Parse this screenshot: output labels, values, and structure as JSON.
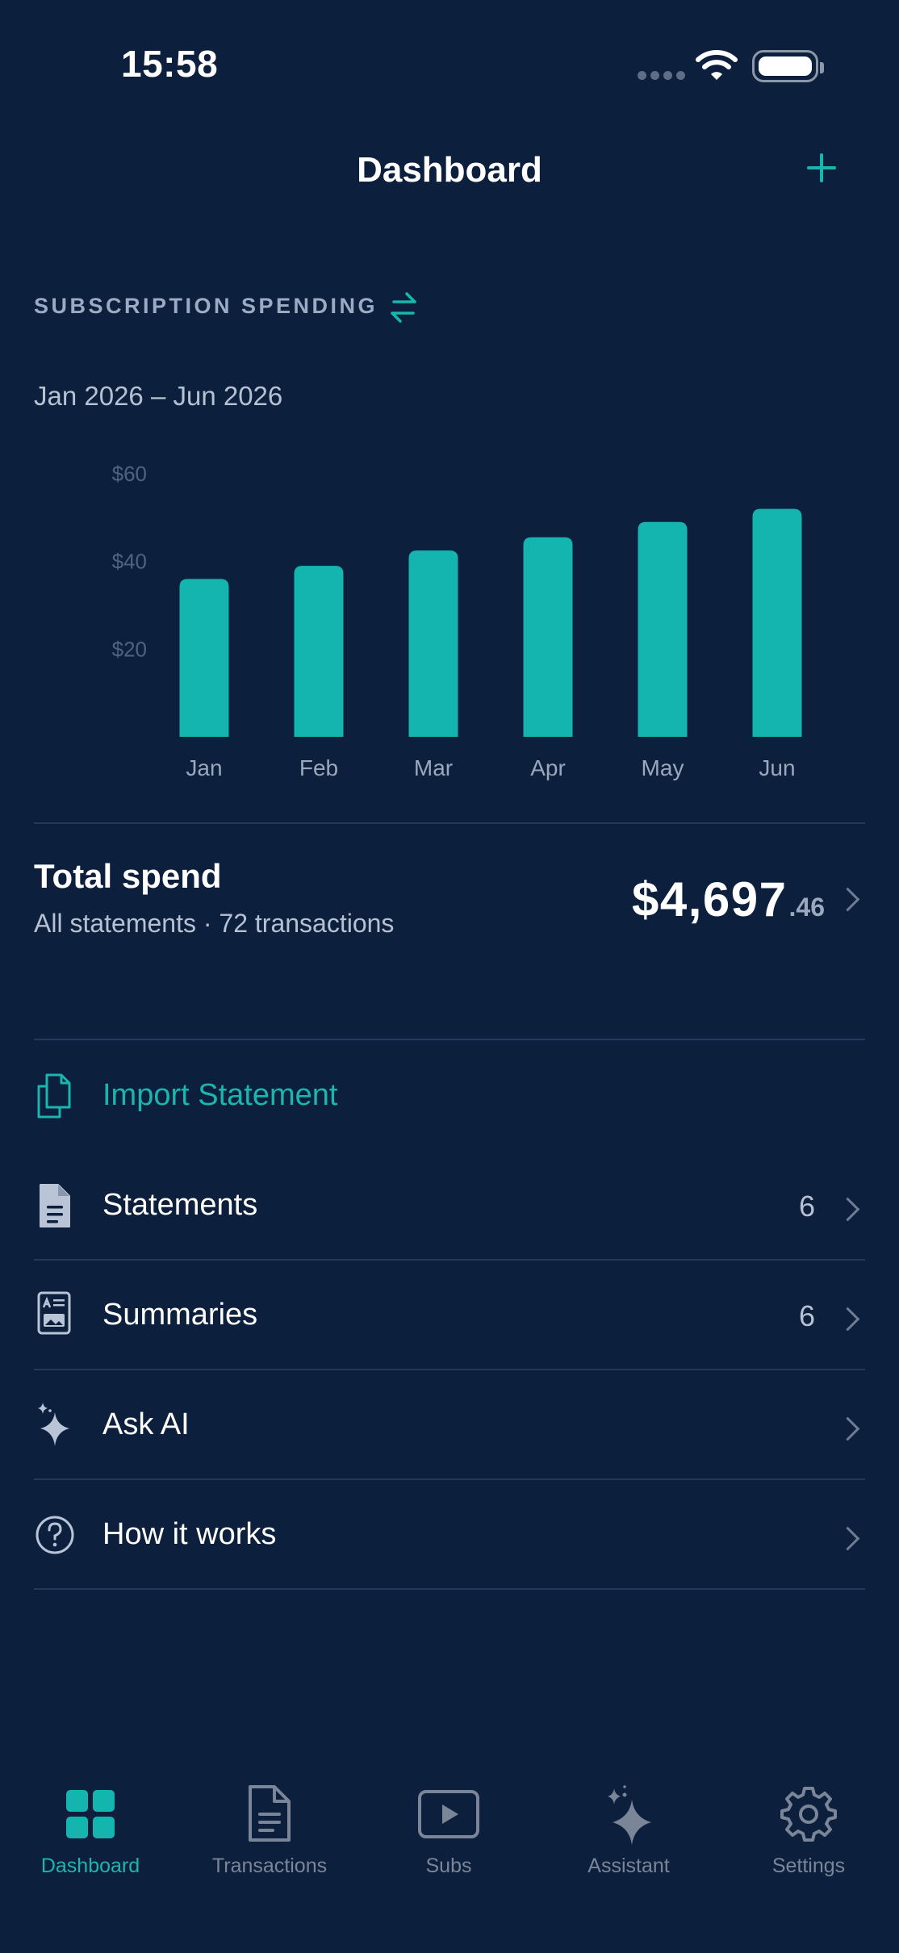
{
  "status_bar": {
    "time": "15:58"
  },
  "header": {
    "title": "Dashboard",
    "add_icon": "plus-icon"
  },
  "spending": {
    "section_title": "SUBSCRIPTION SPENDING",
    "swap_icon": "swap-arrows-icon",
    "date_range": "Jan 2026 – Jun 2026"
  },
  "chart_data": {
    "type": "bar",
    "categories": [
      "Jan",
      "Feb",
      "Mar",
      "Apr",
      "May",
      "Jun"
    ],
    "values": [
      36,
      39,
      42.5,
      45.5,
      49,
      52
    ],
    "y_ticks": [
      "$20",
      "$40",
      "$60"
    ],
    "y_tick_values": [
      20,
      40,
      60
    ],
    "ylim": [
      0,
      60
    ],
    "grid": false,
    "bar_color": "#14b5ae"
  },
  "total": {
    "title": "Total spend",
    "subtitle": "All statements · 72 transactions",
    "amount_main": "$4,697",
    "amount_cents": ".46"
  },
  "import": {
    "label": "Import Statement",
    "icon": "documents-copy-icon"
  },
  "menu": [
    {
      "label": "Statements",
      "count": "6",
      "icon": "document-icon"
    },
    {
      "label": "Summaries",
      "count": "6",
      "icon": "summary-card-icon"
    },
    {
      "label": "Ask AI",
      "count": "",
      "icon": "sparkles-icon"
    },
    {
      "label": "How it works",
      "count": "",
      "icon": "question-circle-icon"
    }
  ],
  "tabbar": [
    {
      "label": "Dashboard",
      "icon": "grid-icon",
      "active": true
    },
    {
      "label": "Transactions",
      "icon": "document-icon",
      "active": false
    },
    {
      "label": "Subs",
      "icon": "play-icon",
      "active": false
    },
    {
      "label": "Assistant",
      "icon": "sparkles-icon",
      "active": false
    },
    {
      "label": "Settings",
      "icon": "gear-icon",
      "active": false
    }
  ],
  "colors": {
    "background": "#0c1f3d",
    "accent": "#1ab6ad",
    "muted": "#b6c1d2"
  }
}
